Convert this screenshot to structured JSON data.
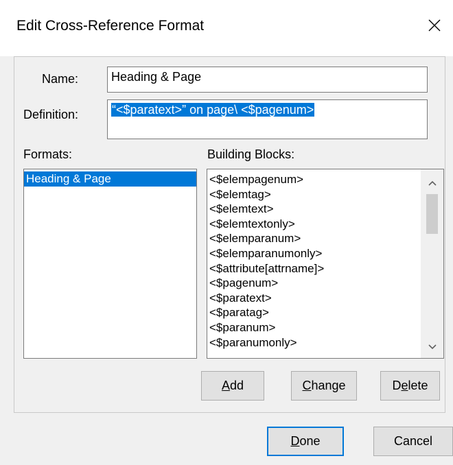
{
  "window": {
    "title": "Edit Cross-Reference Format",
    "close_icon": "close-icon"
  },
  "name": {
    "label": "Name:",
    "value": "Heading & Page"
  },
  "definition": {
    "label": "Definition:",
    "value": "“<$paratext>” on page\\ <$pagenum>"
  },
  "formats": {
    "label": "Formats:",
    "items": [
      "Heading & Page"
    ],
    "selected_index": 0
  },
  "building_blocks": {
    "label": "Building Blocks:",
    "items": [
      "<$elempagenum>",
      "<$elemtag>",
      "<$elemtext>",
      "<$elemtextonly>",
      "<$elemparanum>",
      "<$elemparanumonly>",
      "<$attribute[attrname]>",
      "<$pagenum>",
      "<$paratext>",
      "<$paratag>",
      "<$paranum>",
      "<$paranumonly>"
    ],
    "scroll_up_icon": "chevron-up-icon",
    "scroll_down_icon": "chevron-down-icon"
  },
  "buttons": {
    "add": {
      "pre": "",
      "mnemonic": "A",
      "post": "dd"
    },
    "change": {
      "pre": "",
      "mnemonic": "C",
      "post": "hange"
    },
    "delete": {
      "pre": "D",
      "mnemonic": "e",
      "post": "lete"
    },
    "done": {
      "pre": "",
      "mnemonic": "D",
      "post": "one"
    },
    "cancel": {
      "label": "Cancel"
    }
  },
  "colors": {
    "selection": "#0078d7",
    "dialog_bg": "#f0f0f0"
  }
}
